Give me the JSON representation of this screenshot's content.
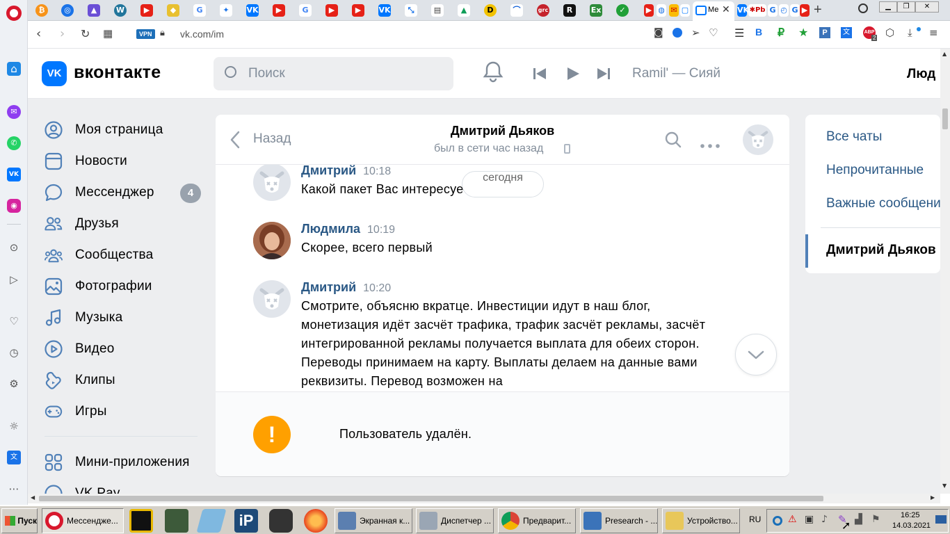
{
  "browser": {
    "tab_title": "Ме",
    "new_tab": "+",
    "url": "vk.com/im",
    "vpn_badge": "VPN",
    "ext_badge": "2"
  },
  "vk": {
    "logo_text": "вконтакте",
    "search_placeholder": "Поиск",
    "now_playing": "Ramil' — Сияй",
    "user_name_partial": "Люд",
    "nav": [
      {
        "label": "Моя страница",
        "icon": "user-icon"
      },
      {
        "label": "Новости",
        "icon": "news-icon"
      },
      {
        "label": "Мессенджер",
        "icon": "chat-icon",
        "badge": "4"
      },
      {
        "label": "Друзья",
        "icon": "friends-icon"
      },
      {
        "label": "Сообщества",
        "icon": "communities-icon"
      },
      {
        "label": "Фотографии",
        "icon": "photo-icon"
      },
      {
        "label": "Музыка",
        "icon": "music-icon"
      },
      {
        "label": "Видео",
        "icon": "video-icon"
      },
      {
        "label": "Клипы",
        "icon": "clips-icon"
      },
      {
        "label": "Игры",
        "icon": "games-icon"
      },
      {
        "label": "Мини-приложения",
        "icon": "apps-icon"
      },
      {
        "label": "VK Pay",
        "icon": "pay-icon"
      }
    ],
    "chat": {
      "back_label": "Назад",
      "contact_name": "Дмитрий Дьяков",
      "status": "был в сети час назад",
      "date_pill": "сегодня",
      "messages": [
        {
          "author": "Дмитрий",
          "time": "10:18",
          "text": "Какой пакет Вас интересует?"
        },
        {
          "author": "Людмила",
          "time": "10:19",
          "text": "Скорее, всего первый"
        },
        {
          "author": "Дмитрий",
          "time": "10:20",
          "text": "Смотрите, объясню вкратце. Инвестиции идут в наш блог, монетизация идёт засчёт трафика, трафик засчёт рекламы, засчёт интегрированной рекламы получается выплата для обеих сторон. Переводы принимаем на карту. Выплаты делаем на данные вами реквизиты. Перевод возможен на"
        }
      ],
      "deleted_notice": "Пользователь удалён."
    },
    "right_panel": {
      "all_chats": "Все чаты",
      "unread": "Непрочитанные",
      "important": "Важные сообщения",
      "current_chat": "Дмитрий Дьяков"
    }
  },
  "taskbar": {
    "start": "Пуск",
    "buttons": [
      "Мессендже...",
      "Экранная к...",
      "Диспетчер ...",
      "Предварит...",
      "Presearch - ...",
      "Устройство..."
    ],
    "lang": "RU",
    "time": "16:25",
    "date": "14.03.2021"
  },
  "colors": {
    "vk_blue": "#0077ff",
    "link": "#2a5885",
    "warning": "#ffa000"
  }
}
